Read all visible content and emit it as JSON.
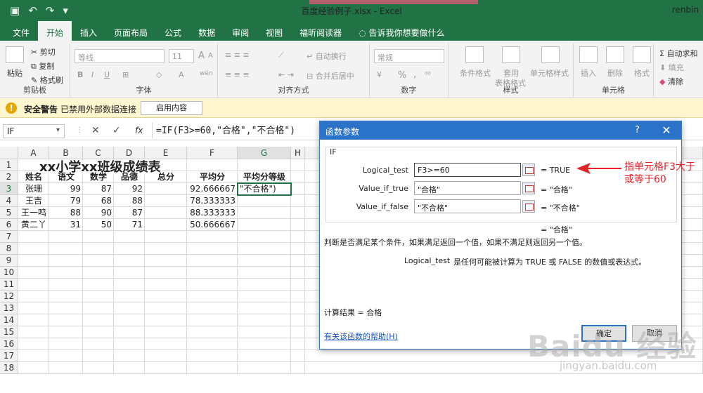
{
  "window": {
    "title": "百度经验例子.xlsx - Excel",
    "user": "renbin"
  },
  "ribbon_tabs": [
    "文件",
    "开始",
    "插入",
    "页面布局",
    "公式",
    "数据",
    "审阅",
    "视图",
    "福昕阅读器",
    "告诉我你想要做什么"
  ],
  "ribbon": {
    "clipboard": {
      "paste": "粘贴",
      "cut": "剪切",
      "copy": "复制",
      "format_painter": "格式刷",
      "group": "剪贴板"
    },
    "font": {
      "name": "等线",
      "size": "11",
      "bold": "B",
      "italic": "I",
      "underline": "U",
      "grow": "A",
      "shrink": "A",
      "font_color": "A",
      "wen": "wén",
      "group": "字体"
    },
    "alignment": {
      "wrap": "自动换行",
      "merge": "合并后居中",
      "group": "对齐方式"
    },
    "number": {
      "format": "常规",
      "percent": "%",
      "comma": ",",
      "group": "数字"
    },
    "styles": {
      "cond": "条件格式",
      "table": "套用",
      "table2": "表格格式",
      "cell": "单元格样式",
      "group": "样式"
    },
    "cells": {
      "insert": "插入",
      "delete": "删除",
      "format": "格式",
      "group": "单元格"
    },
    "editing": {
      "autosum": "自动求和",
      "fill": "填充",
      "clear": "清除"
    }
  },
  "security": {
    "title": "安全警告",
    "message": "已禁用外部数据连接",
    "button": "启用内容"
  },
  "formula_bar": {
    "name_box": "IF",
    "cancel": "✕",
    "enter": "✓",
    "fx": "fx",
    "formula": "=IF(F3>=60,\"合格\",\"不合格\")"
  },
  "sheet": {
    "columns": [
      "A",
      "B",
      "C",
      "D",
      "E",
      "F",
      "G",
      "H"
    ],
    "rows": [
      "1",
      "2",
      "3",
      "4",
      "5",
      "6",
      "7",
      "8",
      "9",
      "10",
      "11",
      "12",
      "13",
      "14",
      "15",
      "16",
      "17",
      "18"
    ],
    "title": "xx小学xx班级成绩表",
    "headers": [
      "姓名",
      "语文",
      "数学",
      "品德",
      "总分",
      "平均分",
      "平均分等级"
    ],
    "data": [
      [
        "张珊",
        "99",
        "87",
        "92",
        "",
        "92.666667",
        "\"不合格\")"
      ],
      [
        "王吉",
        "79",
        "68",
        "88",
        "",
        "78.333333",
        ""
      ],
      [
        "王一鸣",
        "88",
        "90",
        "87",
        "",
        "88.333333",
        ""
      ],
      [
        "黄二丫",
        "31",
        "50",
        "71",
        "",
        "50.666667",
        ""
      ]
    ]
  },
  "dialog": {
    "title": "函数参数",
    "help": "?",
    "close": "✕",
    "function": "IF",
    "args": [
      {
        "label": "Logical_test",
        "value": "F3>=60",
        "result": "=  TRUE"
      },
      {
        "label": "Value_if_true",
        "value": "\"合格\"",
        "result": "=  \"合格\""
      },
      {
        "label": "Value_if_false",
        "value": "\"不合格\"",
        "result": "=  \"不合格\""
      }
    ],
    "overall": "=  \"合格\"",
    "description": "判断是否满足某个条件，如果满足返回一个值，如果不满足则返回另一个值。",
    "arg_name": "Logical_test",
    "arg_description": "是任何可能被计算为 TRUE 或 FALSE 的数值或表达式。",
    "calc_result": "计算结果 =   合格",
    "help_link": "有关该函数的帮助(H)",
    "ok": "确定",
    "cancel": "取消"
  },
  "annotation": "指单元格F3大于或等于60",
  "watermark": "Baidu 经验",
  "watermark_url": "jingyan.baidu.com",
  "colors": {
    "excel_green": "#217346",
    "dialog_blue": "#2b73c9",
    "annotation_red": "#e5232b"
  }
}
